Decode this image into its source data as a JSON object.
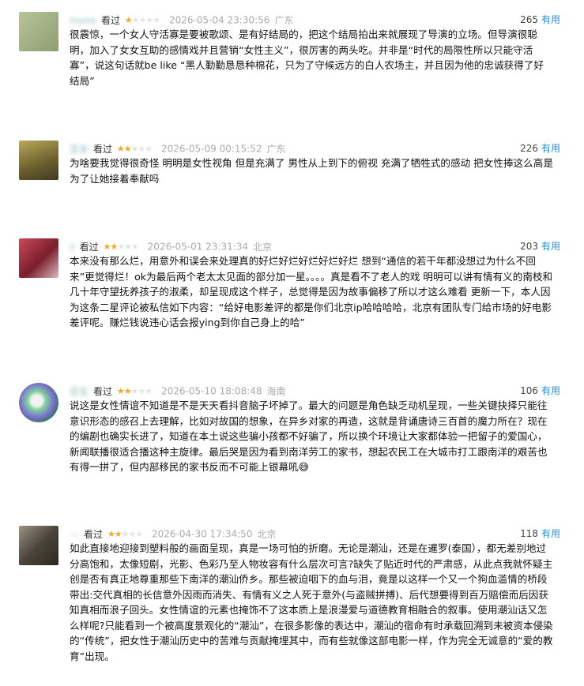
{
  "reviews": [
    {
      "username": "mono",
      "watched_label": "看过",
      "rating": 1,
      "max_rating": 5,
      "time": "2026-05-04 23:30:56",
      "location": "广东",
      "votes": "265",
      "useful_label": "有用",
      "avatar_color": "#a4b48c",
      "content": "很震惊，一个女人守活寡是要被歌颂、是有好结局的，把这个结局拍出来就展现了导演的立场。但导演很聪明，加入了女女互助的感情戏并且营销“女性主义”，很厉害的两头吃。并非是“时代的局限性所以只能守活寡”，说这句话就be like “黑人勤勤恳恳种棉花，只为了守候远方的白人农场主，并且因为他的忠诚获得了好结局”"
    },
    {
      "username": "豆友",
      "watched_label": "看过",
      "rating": 2,
      "max_rating": 5,
      "time": "2026-05-09 00:15:52",
      "location": "广东",
      "votes": "226",
      "useful_label": "有用",
      "avatar_color": "#8c8044",
      "content": "为啥要我觉得很奇怪 明明是女性视角 但是充满了 男性从上到下的俯视 充满了牺牲式的感动 把女性捧这么高是为了让她接着奉献吗"
    },
    {
      "username": "ii",
      "watched_label": "看过",
      "rating": 2,
      "max_rating": 5,
      "time": "2026-05-01 23:31:34",
      "location": "北京",
      "votes": "203",
      "useful_label": "有用",
      "avatar_color": "#8a2f3a",
      "content": "本来没有那么烂，用意外和误会来处理真的好烂好烂好烂好烂好烂 想到“通信的若干年都没想过为什么不回来”更觉得烂！ok为最后两个老太太见面的部分加一星。。。。真是看不了老人的戏 明明可以讲有情有义的南枝和几十年守望抚养孩子的淑柔，却呈现成这个样子，总觉得是因为故事偏移了所以才这么难看 更新一下，本人因为这条二星评论被私信如下内容：“给好电影差评的都是你们北京ip哈哈哈哈，北京有团队专门给市场的好电影差评呢。赚烂钱说违心话会报ying到你自己身上的哈”"
    },
    {
      "username": "豆友",
      "watched_label": "看过",
      "rating": 2,
      "max_rating": 5,
      "time": "2026-05-10 18:08:48",
      "location": "海南",
      "votes": "106",
      "useful_label": "有用",
      "avatar_color": "#6fbf8a",
      "content": "说这是女性情谊不知道是不是天天看抖音脑子坏掉了。最大的问题是角色缺乏动机呈现，一些关键抉择只能往意识形态的感召上去理解，比如对故国的想象，在异乡对家的再造，这就是背诵唐诗三百首的魔力所在？现在的编剧也确实长进了，知道在本土说这些骗小孩都不好骗了，所以换个环境让大家都体验一把留子的爱国心，新闻联播很适合播这种主旋律。最后哭是因为看到南洋劳工的家书，想起农民工在大城市打工跟南洋的艰苦也有得一拼了，但内部移民的家书反而不可能上银幕吼😅"
    },
    {
      "username": "—",
      "watched_label": "看过",
      "rating": 2,
      "max_rating": 5,
      "time": "2026-04-30 17:34:50",
      "location": "北京",
      "votes": "118",
      "useful_label": "有用",
      "avatar_color": "#5a5348",
      "content": "如此直接地迎接到塑料般的画面呈现，真是一场可怕的折磨。无论是潮汕，还是在暹罗(泰国），都无差别地过分高饱和，太像短剧，光影、色彩乃至人物妆容有什么层次可言?缺失了贴近时代的严肃感，从此点我就怀疑主创是否有真正地尊重那些下南洋的潮汕侨乡。那些被迫咽下的血与泪，竟是以这样一个又一个狗血滥情的桥段带出:交代真相的长信意外因雨而消失、有情有义之人死于意外(与盗贼拼搏)、后代想要得到百万赔偿而后因获知真相而浪子回头。女性情谊的元素也掩饰不了这本质上是浪漫爱与道德教育相融合的叙事。使用潮汕话又怎么样呢?只能看到一个被高度景观化的“潮汕”，在很多影像的表达中，潮汕的宿命有时承载回溯到未被资本侵染的“传统”，把女性于潮汕历史中的苦难与贡献掩埋其中，而有些就像这部电影一样，作为完全无诚意的“爱的教育”出现。"
    }
  ]
}
